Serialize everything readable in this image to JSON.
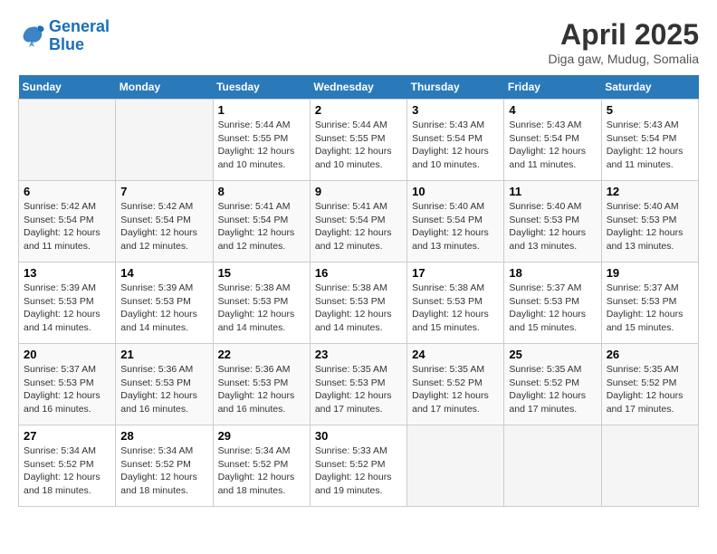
{
  "header": {
    "logo_line1": "General",
    "logo_line2": "Blue",
    "month_title": "April 2025",
    "location": "Diga gaw, Mudug, Somalia"
  },
  "days_of_week": [
    "Sunday",
    "Monday",
    "Tuesday",
    "Wednesday",
    "Thursday",
    "Friday",
    "Saturday"
  ],
  "weeks": [
    [
      {
        "day": "",
        "info": ""
      },
      {
        "day": "",
        "info": ""
      },
      {
        "day": "1",
        "info": "Sunrise: 5:44 AM\nSunset: 5:55 PM\nDaylight: 12 hours and 10 minutes."
      },
      {
        "day": "2",
        "info": "Sunrise: 5:44 AM\nSunset: 5:55 PM\nDaylight: 12 hours and 10 minutes."
      },
      {
        "day": "3",
        "info": "Sunrise: 5:43 AM\nSunset: 5:54 PM\nDaylight: 12 hours and 10 minutes."
      },
      {
        "day": "4",
        "info": "Sunrise: 5:43 AM\nSunset: 5:54 PM\nDaylight: 12 hours and 11 minutes."
      },
      {
        "day": "5",
        "info": "Sunrise: 5:43 AM\nSunset: 5:54 PM\nDaylight: 12 hours and 11 minutes."
      }
    ],
    [
      {
        "day": "6",
        "info": "Sunrise: 5:42 AM\nSunset: 5:54 PM\nDaylight: 12 hours and 11 minutes."
      },
      {
        "day": "7",
        "info": "Sunrise: 5:42 AM\nSunset: 5:54 PM\nDaylight: 12 hours and 12 minutes."
      },
      {
        "day": "8",
        "info": "Sunrise: 5:41 AM\nSunset: 5:54 PM\nDaylight: 12 hours and 12 minutes."
      },
      {
        "day": "9",
        "info": "Sunrise: 5:41 AM\nSunset: 5:54 PM\nDaylight: 12 hours and 12 minutes."
      },
      {
        "day": "10",
        "info": "Sunrise: 5:40 AM\nSunset: 5:54 PM\nDaylight: 12 hours and 13 minutes."
      },
      {
        "day": "11",
        "info": "Sunrise: 5:40 AM\nSunset: 5:53 PM\nDaylight: 12 hours and 13 minutes."
      },
      {
        "day": "12",
        "info": "Sunrise: 5:40 AM\nSunset: 5:53 PM\nDaylight: 12 hours and 13 minutes."
      }
    ],
    [
      {
        "day": "13",
        "info": "Sunrise: 5:39 AM\nSunset: 5:53 PM\nDaylight: 12 hours and 14 minutes."
      },
      {
        "day": "14",
        "info": "Sunrise: 5:39 AM\nSunset: 5:53 PM\nDaylight: 12 hours and 14 minutes."
      },
      {
        "day": "15",
        "info": "Sunrise: 5:38 AM\nSunset: 5:53 PM\nDaylight: 12 hours and 14 minutes."
      },
      {
        "day": "16",
        "info": "Sunrise: 5:38 AM\nSunset: 5:53 PM\nDaylight: 12 hours and 14 minutes."
      },
      {
        "day": "17",
        "info": "Sunrise: 5:38 AM\nSunset: 5:53 PM\nDaylight: 12 hours and 15 minutes."
      },
      {
        "day": "18",
        "info": "Sunrise: 5:37 AM\nSunset: 5:53 PM\nDaylight: 12 hours and 15 minutes."
      },
      {
        "day": "19",
        "info": "Sunrise: 5:37 AM\nSunset: 5:53 PM\nDaylight: 12 hours and 15 minutes."
      }
    ],
    [
      {
        "day": "20",
        "info": "Sunrise: 5:37 AM\nSunset: 5:53 PM\nDaylight: 12 hours and 16 minutes."
      },
      {
        "day": "21",
        "info": "Sunrise: 5:36 AM\nSunset: 5:53 PM\nDaylight: 12 hours and 16 minutes."
      },
      {
        "day": "22",
        "info": "Sunrise: 5:36 AM\nSunset: 5:53 PM\nDaylight: 12 hours and 16 minutes."
      },
      {
        "day": "23",
        "info": "Sunrise: 5:35 AM\nSunset: 5:53 PM\nDaylight: 12 hours and 17 minutes."
      },
      {
        "day": "24",
        "info": "Sunrise: 5:35 AM\nSunset: 5:52 PM\nDaylight: 12 hours and 17 minutes."
      },
      {
        "day": "25",
        "info": "Sunrise: 5:35 AM\nSunset: 5:52 PM\nDaylight: 12 hours and 17 minutes."
      },
      {
        "day": "26",
        "info": "Sunrise: 5:35 AM\nSunset: 5:52 PM\nDaylight: 12 hours and 17 minutes."
      }
    ],
    [
      {
        "day": "27",
        "info": "Sunrise: 5:34 AM\nSunset: 5:52 PM\nDaylight: 12 hours and 18 minutes."
      },
      {
        "day": "28",
        "info": "Sunrise: 5:34 AM\nSunset: 5:52 PM\nDaylight: 12 hours and 18 minutes."
      },
      {
        "day": "29",
        "info": "Sunrise: 5:34 AM\nSunset: 5:52 PM\nDaylight: 12 hours and 18 minutes."
      },
      {
        "day": "30",
        "info": "Sunrise: 5:33 AM\nSunset: 5:52 PM\nDaylight: 12 hours and 19 minutes."
      },
      {
        "day": "",
        "info": ""
      },
      {
        "day": "",
        "info": ""
      },
      {
        "day": "",
        "info": ""
      }
    ]
  ]
}
